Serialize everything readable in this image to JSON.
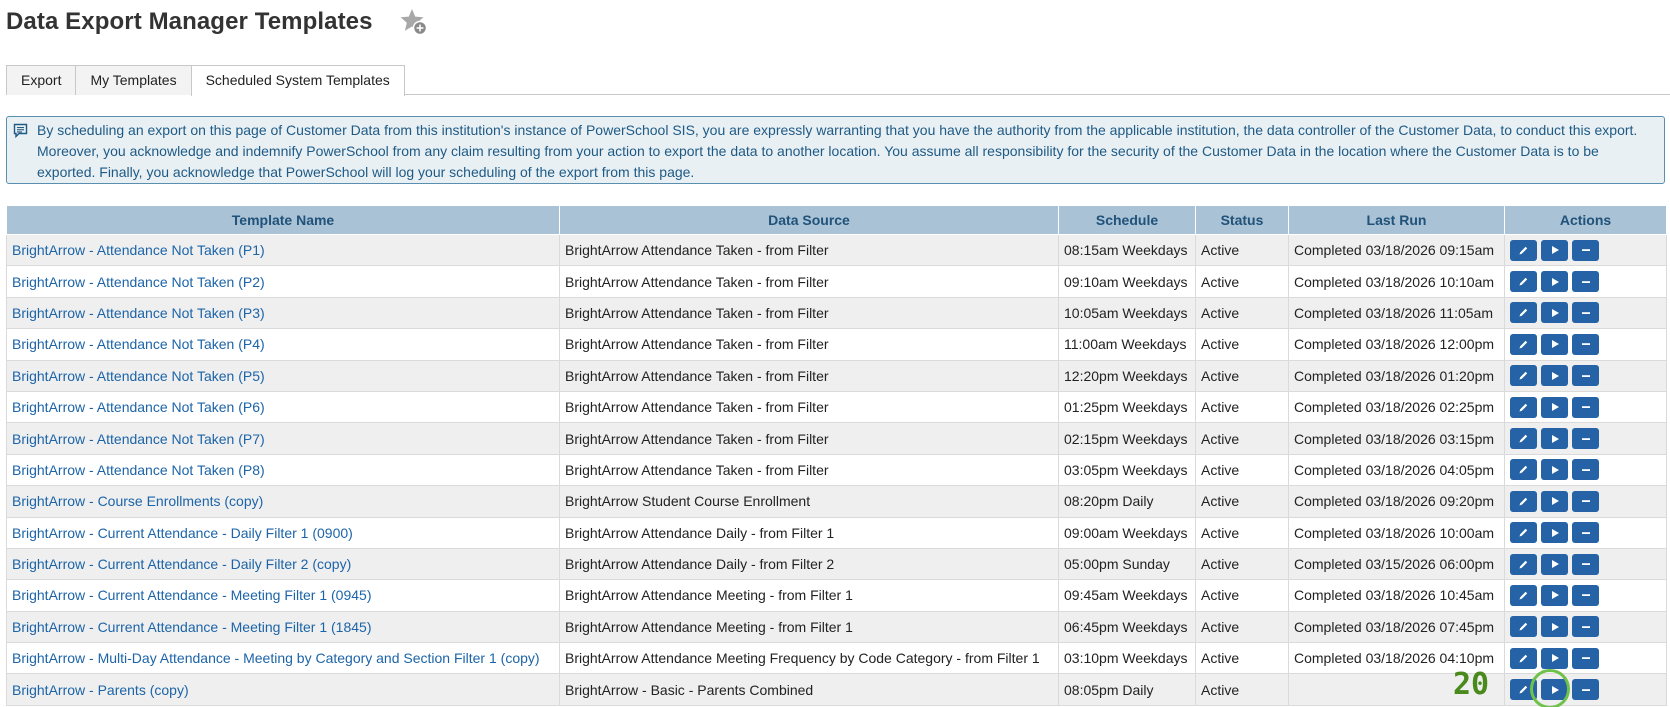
{
  "page": {
    "title": "Data Export Manager Templates",
    "favorite_icon": "star-plus-icon"
  },
  "tabs": [
    {
      "label": "Export"
    },
    {
      "label": "My Templates"
    },
    {
      "label": "Scheduled System Templates",
      "active": true
    }
  ],
  "notice": {
    "icon": "message-icon",
    "text": "By scheduling an export on this page of Customer Data from this institution's instance of PowerSchool SIS, you are expressly warranting that you have the authority from the applicable institution, the data controller of the Customer Data, to conduct this export. Moreover, you acknowledge and indemnify PowerSchool from any claim resulting from your action to export the data to another location. You assume all responsibility for the security of the Customer Data in the location where the Customer Data is to be exported. Finally, you acknowledge that PowerSchool will log your scheduling of the export from this page."
  },
  "table": {
    "headers": {
      "name": "Template Name",
      "source": "Data Source",
      "schedule": "Schedule",
      "status": "Status",
      "last_run": "Last Run",
      "actions": "Actions"
    },
    "rows": [
      {
        "name": "BrightArrow - Attendance Not Taken (P1)",
        "source": "BrightArrow Attendance Taken - from Filter",
        "schedule": "08:15am Weekdays",
        "status": "Active",
        "last_run": "Completed 03/18/2026 09:15am"
      },
      {
        "name": "BrightArrow - Attendance Not Taken (P2)",
        "source": "BrightArrow Attendance Taken - from Filter",
        "schedule": "09:10am Weekdays",
        "status": "Active",
        "last_run": "Completed 03/18/2026 10:10am"
      },
      {
        "name": "BrightArrow - Attendance Not Taken (P3)",
        "source": "BrightArrow Attendance Taken - from Filter",
        "schedule": "10:05am Weekdays",
        "status": "Active",
        "last_run": "Completed 03/18/2026 11:05am"
      },
      {
        "name": "BrightArrow - Attendance Not Taken (P4)",
        "source": "BrightArrow Attendance Taken - from Filter",
        "schedule": "11:00am Weekdays",
        "status": "Active",
        "last_run": "Completed 03/18/2026 12:00pm"
      },
      {
        "name": "BrightArrow - Attendance Not Taken (P5)",
        "source": "BrightArrow Attendance Taken - from Filter",
        "schedule": "12:20pm Weekdays",
        "status": "Active",
        "last_run": "Completed 03/18/2026 01:20pm"
      },
      {
        "name": "BrightArrow - Attendance Not Taken (P6)",
        "source": "BrightArrow Attendance Taken - from Filter",
        "schedule": "01:25pm Weekdays",
        "status": "Active",
        "last_run": "Completed 03/18/2026 02:25pm"
      },
      {
        "name": "BrightArrow - Attendance Not Taken (P7)",
        "source": "BrightArrow Attendance Taken - from Filter",
        "schedule": "02:15pm Weekdays",
        "status": "Active",
        "last_run": "Completed 03/18/2026 03:15pm"
      },
      {
        "name": "BrightArrow - Attendance Not Taken (P8)",
        "source": "BrightArrow Attendance Taken - from Filter",
        "schedule": "03:05pm Weekdays",
        "status": "Active",
        "last_run": "Completed 03/18/2026 04:05pm"
      },
      {
        "name": "BrightArrow - Course Enrollments (copy)",
        "source": "BrightArrow Student Course Enrollment",
        "schedule": "08:20pm Daily",
        "status": "Active",
        "last_run": "Completed 03/18/2026 09:20pm"
      },
      {
        "name": "BrightArrow - Current Attendance - Daily Filter 1 (0900)",
        "source": "BrightArrow Attendance Daily - from Filter 1",
        "schedule": "09:00am Weekdays",
        "status": "Active",
        "last_run": "Completed 03/18/2026 10:00am"
      },
      {
        "name": "BrightArrow - Current Attendance - Daily Filter 2 (copy)",
        "source": "BrightArrow Attendance Daily - from Filter 2",
        "schedule": "05:00pm Sunday",
        "status": "Active",
        "last_run": "Completed 03/15/2026 06:00pm"
      },
      {
        "name": "BrightArrow - Current Attendance - Meeting Filter 1 (0945)",
        "source": "BrightArrow Attendance Meeting - from Filter 1",
        "schedule": "09:45am Weekdays",
        "status": "Active",
        "last_run": "Completed 03/18/2026 10:45am"
      },
      {
        "name": "BrightArrow - Current Attendance - Meeting Filter 1 (1845)",
        "source": "BrightArrow Attendance Meeting - from Filter 1",
        "schedule": "06:45pm Weekdays",
        "status": "Active",
        "last_run": "Completed 03/18/2026 07:45pm"
      },
      {
        "name": "BrightArrow - Multi-Day Attendance - Meeting by Category and Section Filter 1 (copy)",
        "source": "BrightArrow Attendance Meeting Frequency by Code Category - from Filter 1",
        "schedule": "03:10pm Weekdays",
        "status": "Active",
        "last_run": "Completed 03/18/2026 04:10pm"
      },
      {
        "name": "BrightArrow - Parents (copy)",
        "source": "BrightArrow - Basic - Parents Combined",
        "schedule": "08:05pm Daily",
        "status": "Active",
        "last_run": ""
      }
    ],
    "action_icons": [
      "edit-icon",
      "run-icon",
      "remove-icon"
    ]
  },
  "overlay": {
    "step_number": "20"
  },
  "colors": {
    "header_bg": "#a9c2d6",
    "header_text": "#21527a",
    "link": "#1c64a8",
    "action_button": "#2563a6",
    "notice_bg": "#e8f0f4",
    "notice_border": "#5b8fb0",
    "highlight": "#6ec24a"
  }
}
